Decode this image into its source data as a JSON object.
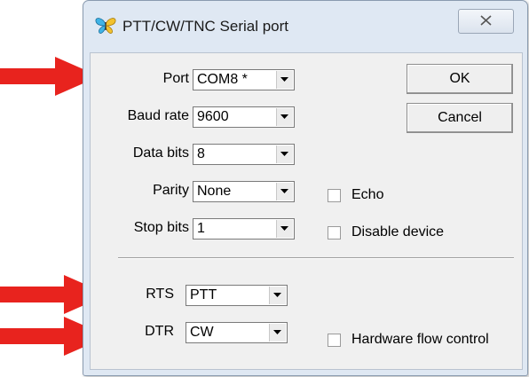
{
  "window": {
    "title": "PTT/CW/TNC Serial port",
    "close_glyph": "✕"
  },
  "fields": [
    {
      "label": "Port",
      "value": "COM8 *"
    },
    {
      "label": "Baud rate",
      "value": "9600"
    },
    {
      "label": "Data bits",
      "value": "8"
    },
    {
      "label": "Parity",
      "value": "None"
    },
    {
      "label": "Stop bits",
      "value": "1"
    }
  ],
  "control_lines": [
    {
      "label": "RTS",
      "value": "PTT"
    },
    {
      "label": "DTR",
      "value": "CW"
    }
  ],
  "buttons": {
    "ok": "OK",
    "cancel": "Cancel"
  },
  "checkboxes": {
    "echo": {
      "label": "Echo",
      "checked": false
    },
    "disable_device": {
      "label": "Disable device",
      "checked": false
    },
    "hardware_flow_control": {
      "label": "Hardware flow control",
      "checked": false
    }
  },
  "annotation_color": "#e8231e"
}
